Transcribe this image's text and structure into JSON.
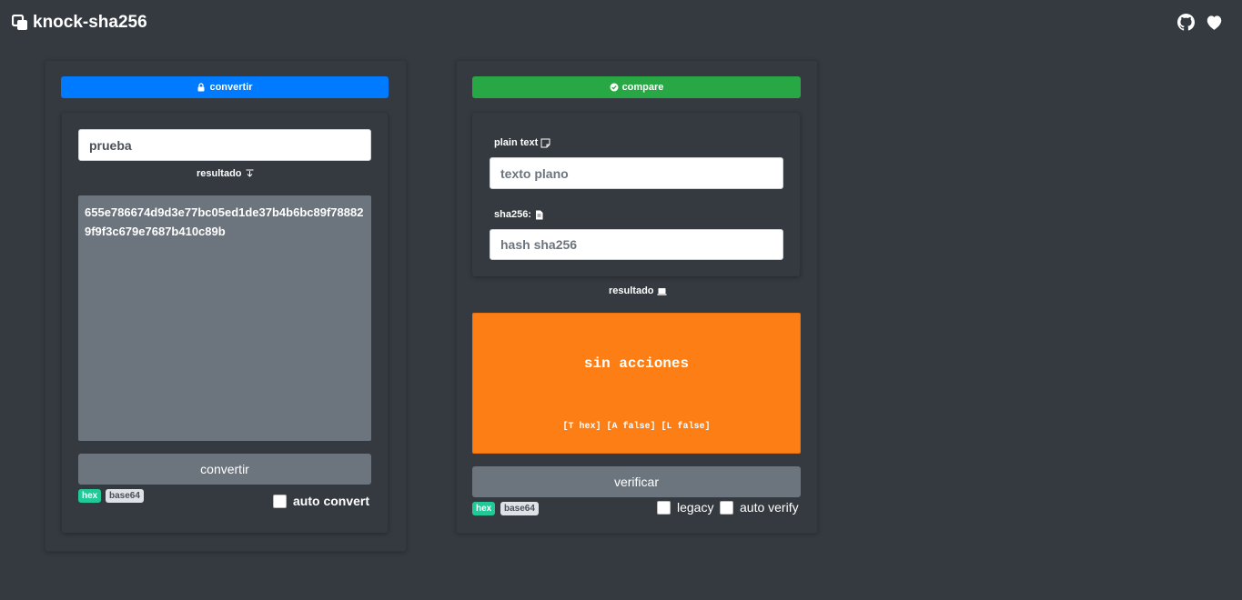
{
  "app": {
    "title": "knock-sha256"
  },
  "nav": {
    "icons": [
      "github-icon",
      "heart-icon"
    ]
  },
  "convert_panel": {
    "header_label": "convertir",
    "input_value": "prueba",
    "result_label": "resultado",
    "result_value": "655e786674d9d3e77bc05ed1de37b4b6bc89f788829f9f3c679e7687b410c89b",
    "button_label": "convertir",
    "badges": [
      "hex",
      "base64"
    ],
    "auto_convert_label": "auto convert"
  },
  "compare_panel": {
    "header_label": "compare",
    "plain_text_label": "plain text",
    "plain_text_placeholder": "texto plano",
    "sha_label": "sha256:",
    "hash_placeholder": "hash sha256",
    "result_label": "resultado",
    "status_title": "sin acciones",
    "status_flags": "[T hex] [A false] [L false]",
    "button_label": "verificar",
    "badges": [
      "hex",
      "base64"
    ],
    "legacy_label": "legacy",
    "auto_verify_label": "auto verify"
  },
  "colors": {
    "background": "#343a40",
    "convert_header": "#007bff",
    "compare_header": "#28a745",
    "status_panel": "#fd7e14",
    "result_area": "#6c757d",
    "badge_hex": "#20c997"
  }
}
